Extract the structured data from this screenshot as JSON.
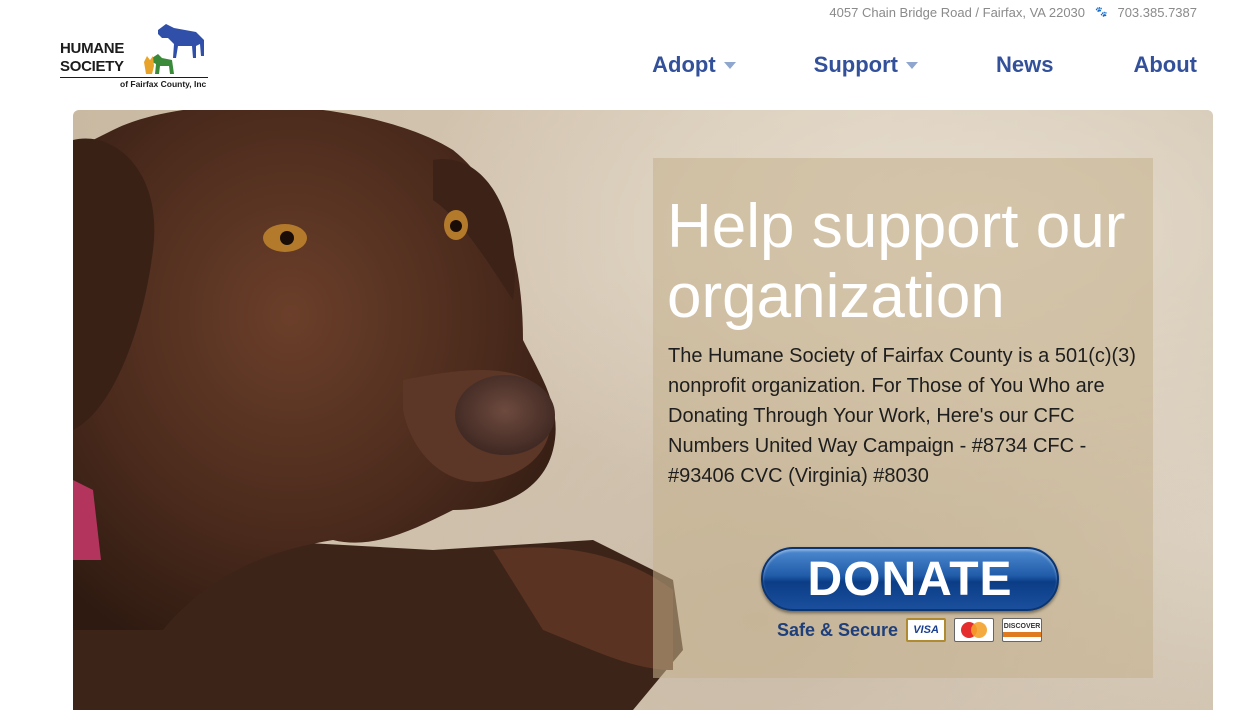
{
  "header": {
    "address": "4057 Chain Bridge Road / Fairfax, VA 22030",
    "phone": "703.385.7387",
    "logo": {
      "line1": "HUMANE",
      "line2": "SOCIETY",
      "subtitle": "of Fairfax County, Inc"
    }
  },
  "nav": {
    "items": [
      {
        "label": "Adopt",
        "has_dropdown": true
      },
      {
        "label": "Support",
        "has_dropdown": true
      },
      {
        "label": "News",
        "has_dropdown": false
      },
      {
        "label": "About",
        "has_dropdown": false
      }
    ]
  },
  "hero": {
    "title": "Help support our organization",
    "text": "The Humane Society of Fairfax County is a 501(c)(3) nonprofit organization. For Those of You Who are Donating Through Your Work, Here's our CFC Numbers United Way Campaign - #8734 CFC - #93406 CVC (Virginia) #8030",
    "donate_label": "DONATE",
    "secure_label": "Safe & Secure",
    "cards": [
      "VISA",
      "MasterCard",
      "DISCOVER"
    ]
  },
  "colors": {
    "nav": "#33519a",
    "donate": "#1f5ba8",
    "logo_horse": "#2f4fa8"
  }
}
